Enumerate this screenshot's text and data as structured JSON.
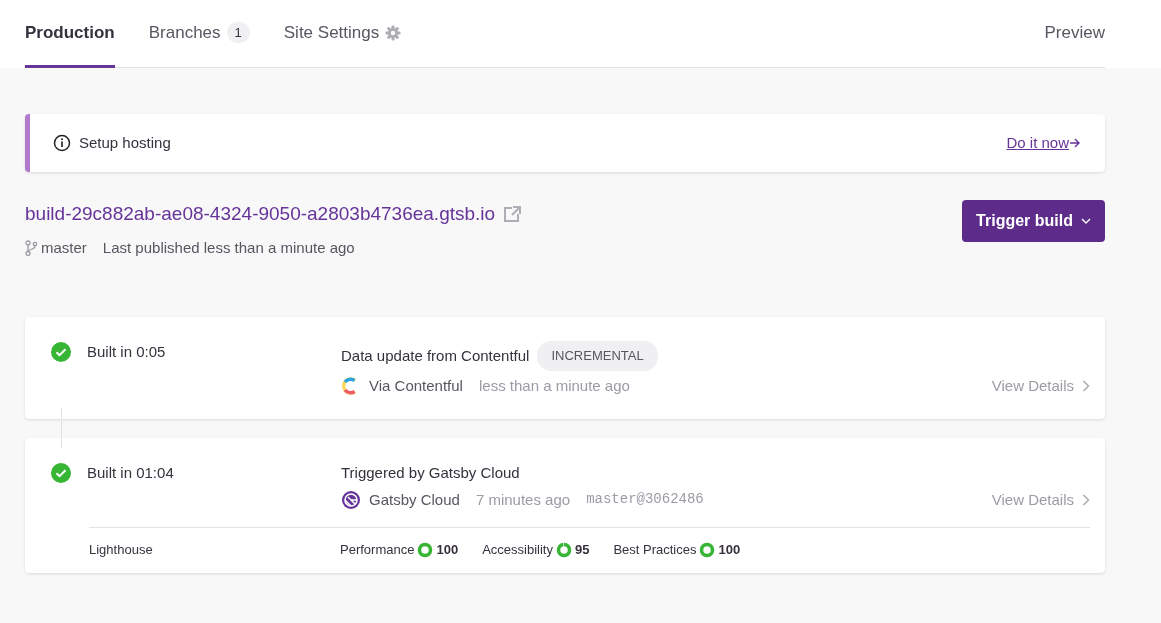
{
  "tabs": [
    {
      "label": "Production",
      "selected": true
    },
    {
      "label": "Branches",
      "badge": "1",
      "selected": false
    },
    {
      "label": "Site Settings",
      "kind": "settings",
      "selected": false
    }
  ],
  "preview": "Preview",
  "banner": {
    "text": "Setup hosting",
    "action": "Do it now"
  },
  "site": {
    "url": "build-29c882ab-ae08-4324-9050-a2803b4736ea.gtsb.io",
    "branch": "master",
    "published": "Last published less than a minute ago",
    "button": "Trigger build"
  },
  "builds": [
    {
      "duration": "Built in 0:05",
      "title": "Data update from Contentful",
      "tag": "INCREMENTAL",
      "source": {
        "kind": "contentful",
        "name": "Via Contentful"
      },
      "time": "less than a minute ago",
      "details": "View Details"
    },
    {
      "duration": "Built in 01:04",
      "title": "Triggered by Gatsby Cloud",
      "source": {
        "kind": "gatsby",
        "name": "Gatsby Cloud"
      },
      "time": "7 minutes ago",
      "commit": "master@3062486",
      "details": "View Details",
      "lighthouse": {
        "label": "Lighthouse",
        "scores": [
          {
            "name": "Performance",
            "value": "100"
          },
          {
            "name": "Accessibility",
            "value": "95"
          },
          {
            "name": "Best Practices",
            "value": "100"
          }
        ]
      }
    }
  ]
}
